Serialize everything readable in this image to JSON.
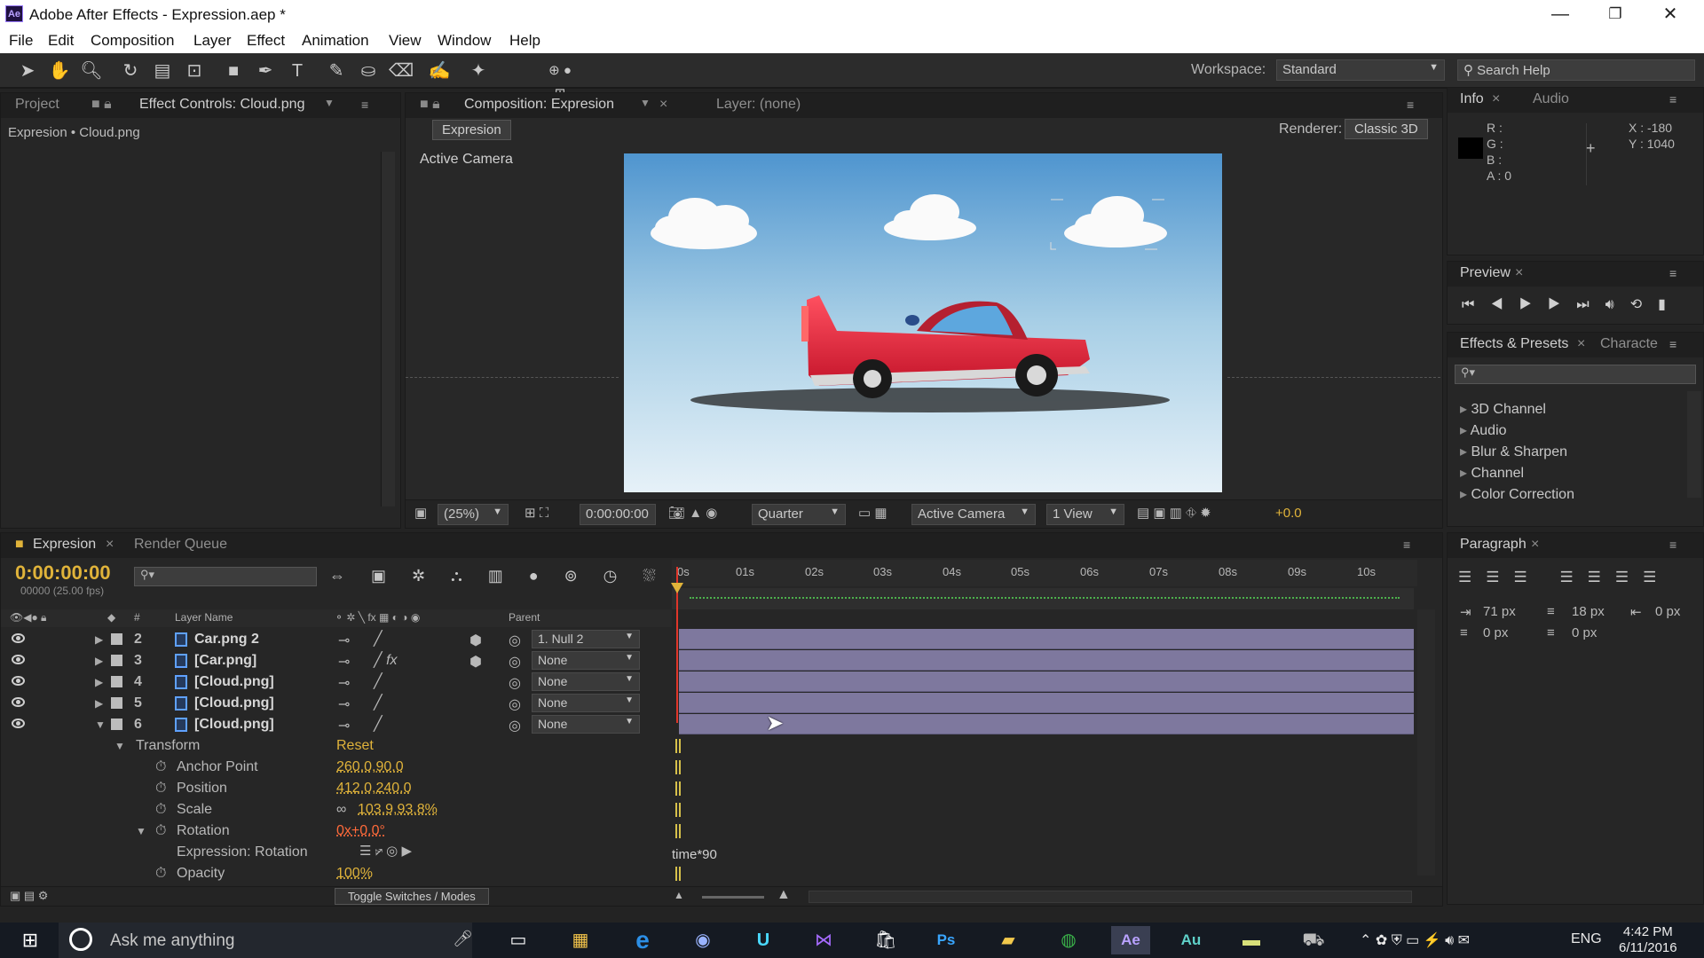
{
  "window": {
    "title": "Adobe After Effects - Expression.aep *",
    "logo": "Ae",
    "min": "—",
    "restore": "❐",
    "close": "✕"
  },
  "menu": [
    "File",
    "Edit",
    "Composition",
    "Layer",
    "Effect",
    "Animation",
    "View",
    "Window",
    "Help"
  ],
  "toolbar": {
    "workspace_label": "Workspace:",
    "workspace_value": "Standard",
    "search_placeholder": "Search Help"
  },
  "left_panel": {
    "tab_project": "Project",
    "tab_effect_controls": "Effect Controls: Cloud.png",
    "breadcrumb": "Expresion • Cloud.png"
  },
  "comp_panel": {
    "tab": "Composition: Expresion",
    "layer_tab": "Layer: (none)",
    "comp_name": "Expresion",
    "renderer_label": "Renderer:",
    "renderer_value": "Classic 3D",
    "view_label": "Active Camera",
    "zoom": "(25%)",
    "timecode": "0:00:00:00",
    "resolution": "Quarter",
    "camera": "Active Camera",
    "views": "1 View",
    "exposure": "+0.0"
  },
  "info_panel": {
    "tab_info": "Info",
    "tab_audio": "Audio",
    "r": "R :",
    "g": "G :",
    "b": "B :",
    "a": "A : 0",
    "x": "X : -180",
    "y": "Y : 1040"
  },
  "preview_panel": {
    "tab": "Preview"
  },
  "effects_panel": {
    "tab": "Effects & Presets",
    "tab2": "Characte",
    "items": [
      "3D Channel",
      "Audio",
      "Blur & Sharpen",
      "Channel",
      "Color Correction"
    ]
  },
  "paragraph_panel": {
    "tab": "Paragraph",
    "indent_left": "71 px",
    "indent_first": "18 px",
    "indent_right": "0 px",
    "space_before": "0 px",
    "space_after": "0 px"
  },
  "timeline": {
    "tab": "Expresion",
    "render_tab": "Render Queue",
    "timecode": "0:00:00:00",
    "frames": "00000 (25.00 fps)",
    "col_num": "#",
    "col_layer_name": "Layer Name",
    "col_parent": "Parent",
    "ruler": [
      "0s",
      "01s",
      "02s",
      "03s",
      "04s",
      "05s",
      "06s",
      "07s",
      "08s",
      "09s",
      "10s"
    ],
    "layers": [
      {
        "num": "2",
        "name": "Car.png 2",
        "parent": "1. Null 2"
      },
      {
        "num": "3",
        "name": "[Car.png]",
        "parent": "None"
      },
      {
        "num": "4",
        "name": "[Cloud.png]",
        "parent": "None"
      },
      {
        "num": "5",
        "name": "[Cloud.png]",
        "parent": "None"
      },
      {
        "num": "6",
        "name": "[Cloud.png]",
        "parent": "None"
      }
    ],
    "transform_label": "Transform",
    "reset": "Reset",
    "props": [
      {
        "name": "Anchor Point",
        "value": "260.0,90.0"
      },
      {
        "name": "Position",
        "value": "412.0,240.0"
      },
      {
        "name": "Scale",
        "value": "103.9,93.8%"
      },
      {
        "name": "Rotation",
        "value": "0x+0.0°"
      },
      {
        "name": "Expression: Rotation",
        "value": ""
      },
      {
        "name": "Opacity",
        "value": "100%"
      }
    ],
    "expression_text": "time*90",
    "toggle_label": "Toggle Switches / Modes"
  },
  "taskbar": {
    "search_text": "Ask me anything",
    "lang": "ENG",
    "time": "4:42 PM",
    "date": "6/11/2016"
  },
  "colors": {
    "accent": "#e0b33a",
    "track": "#7e789e",
    "sky_top": "#5a9fd4",
    "car_red": "#e3283c"
  }
}
